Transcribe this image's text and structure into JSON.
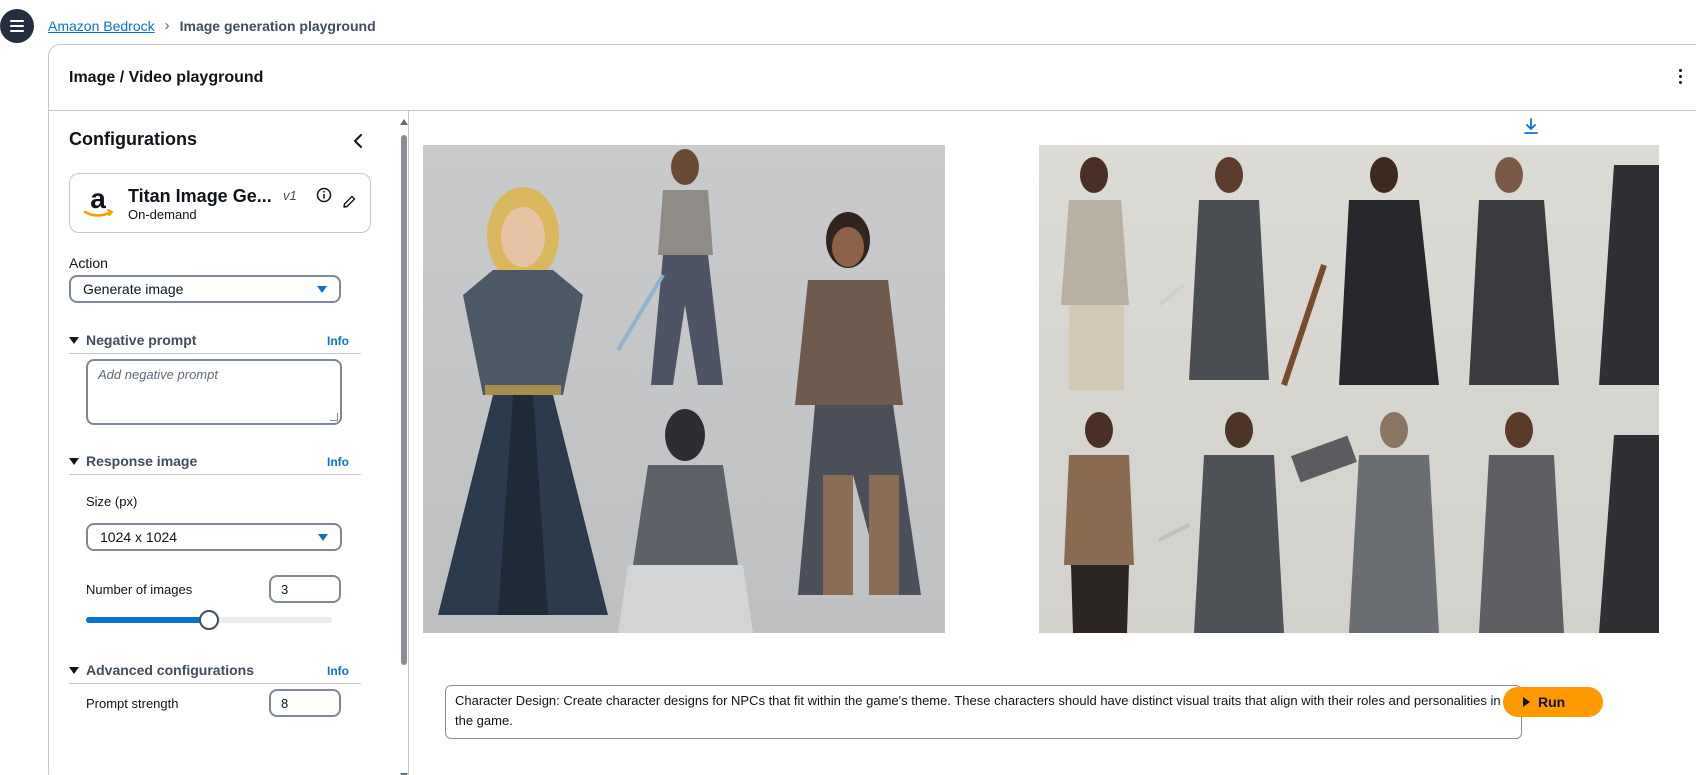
{
  "breadcrumb": {
    "root": "Amazon Bedrock",
    "current": "Image generation playground"
  },
  "header": {
    "title": "Image / Video playground"
  },
  "config": {
    "title": "Configurations",
    "model": {
      "name": "Titan Image Ge...",
      "version": "v1",
      "mode": "On-demand"
    },
    "action": {
      "label": "Action",
      "value": "Generate image"
    },
    "negative_prompt": {
      "title": "Negative prompt",
      "info": "Info",
      "placeholder": "Add negative prompt"
    },
    "response_image": {
      "title": "Response image",
      "info": "Info",
      "size_label": "Size (px)",
      "size_value": "1024 x 1024",
      "num_images_label": "Number of images",
      "num_images_value": "3",
      "num_images_slider_fraction": 0.5
    },
    "advanced": {
      "title": "Advanced configurations",
      "info": "Info",
      "prompt_strength_label": "Prompt strength",
      "prompt_strength_value": "8"
    }
  },
  "prompt": {
    "text": "Character Design: Create character designs for NPCs that fit within the game's theme. These characters should have distinct visual traits that align with their roles and personalities in the game."
  },
  "run_button": {
    "label": "Run"
  },
  "colors": {
    "accent": "#0972d3",
    "run": "#ff9900",
    "dark": "#232f3e"
  }
}
